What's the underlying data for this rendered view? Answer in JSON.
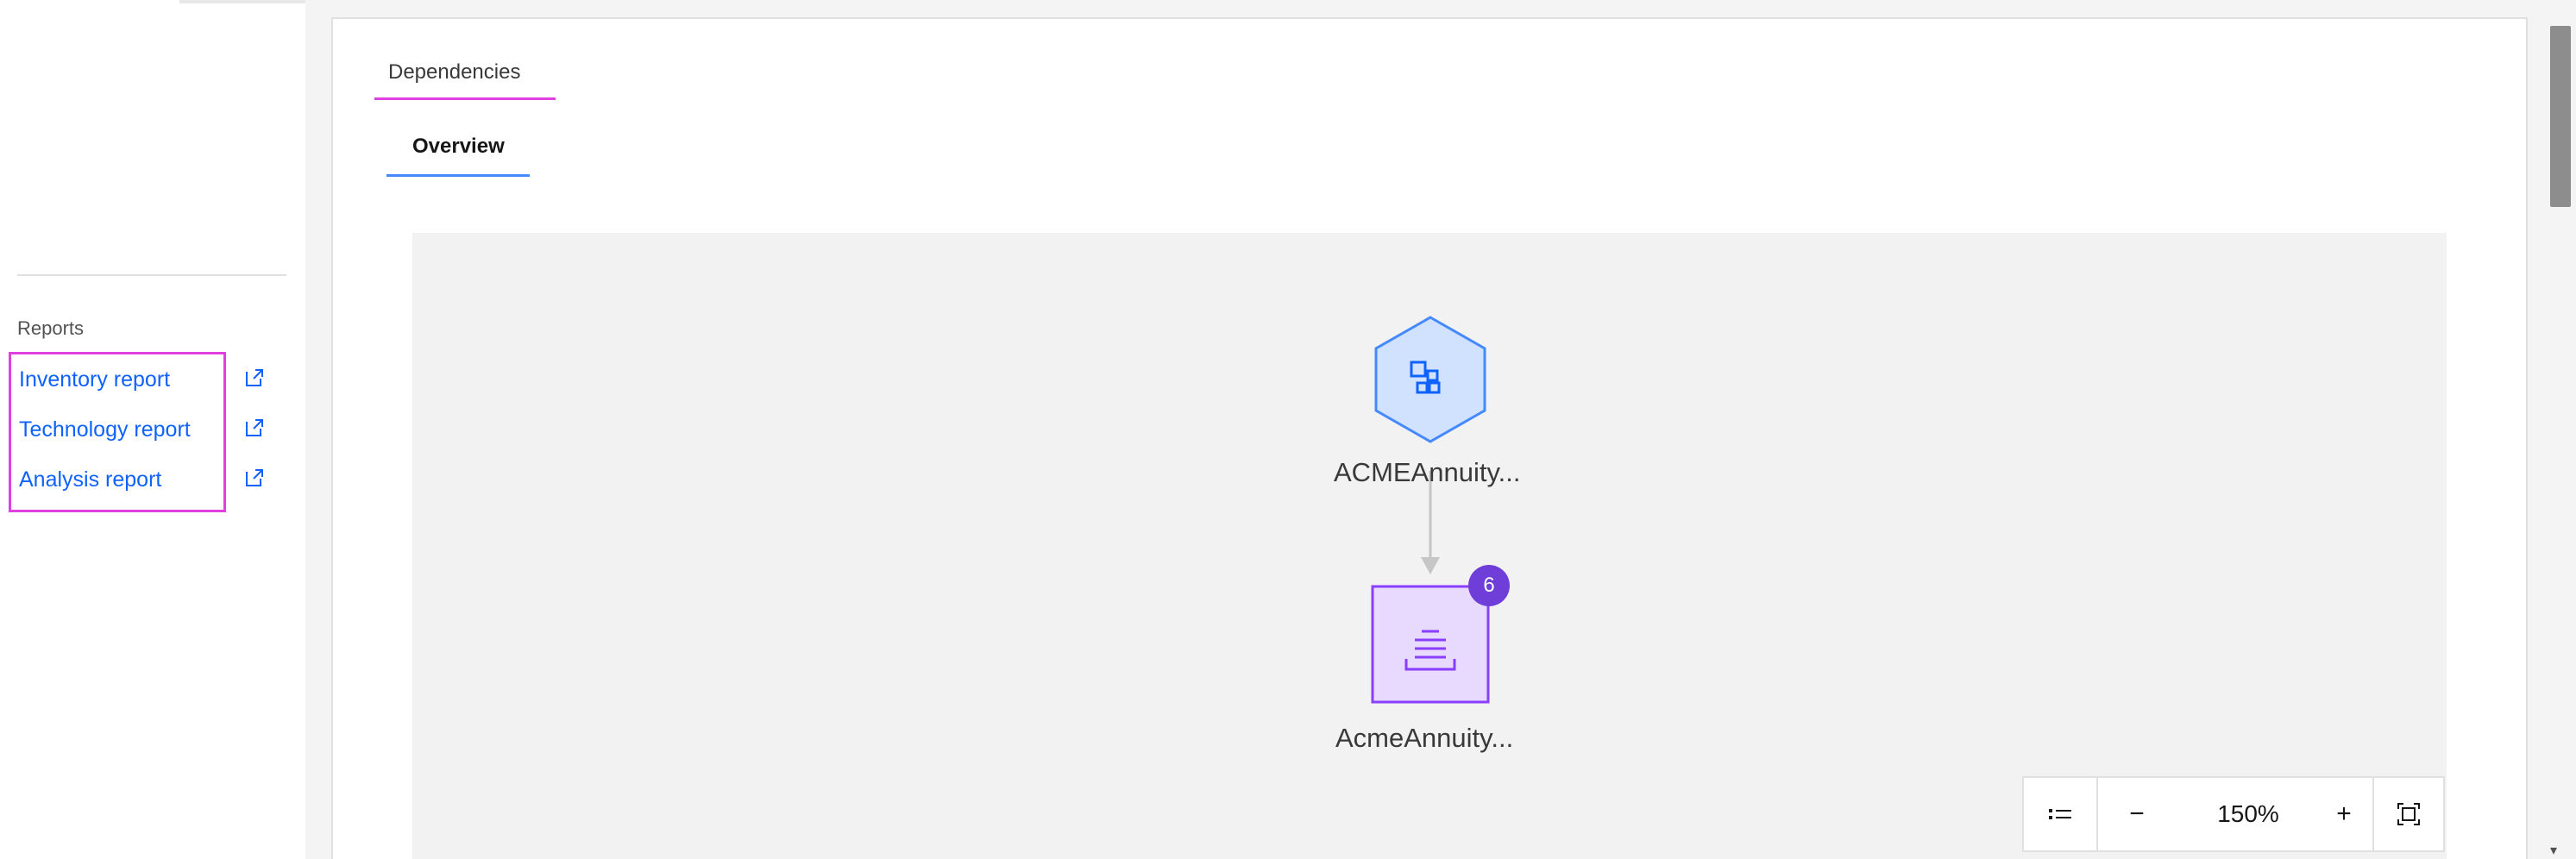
{
  "sidebar": {
    "section_label": "Reports",
    "reports": [
      {
        "label": "Inventory report",
        "icon": "external-link-icon"
      },
      {
        "label": "Technology report",
        "icon": "external-link-icon"
      },
      {
        "label": "Analysis report",
        "icon": "external-link-icon"
      }
    ]
  },
  "tabs": {
    "primary": "Dependencies",
    "secondary": "Overview"
  },
  "graph": {
    "nodes": [
      {
        "label": "ACMEAnnuity...",
        "icon": "application-icon",
        "shape": "hexagon"
      },
      {
        "label": "AcmeAnnuity...",
        "icon": "data-list-icon",
        "shape": "square",
        "badge": "6"
      }
    ]
  },
  "zoom": {
    "level": "150%",
    "decrease_label": "−",
    "increase_label": "+",
    "legend_icon": "list-legend-icon",
    "fit_icon": "fit-to-screen-icon"
  },
  "colors": {
    "link": "#0f62fe",
    "highlight": "#e040e0",
    "tab_underline": "#4589ff",
    "badge": "#6f3ed8",
    "app_node_fill": "#d0e2ff",
    "app_node_stroke": "#4589ff",
    "data_node_fill": "#e8daff",
    "data_node_stroke": "#8a3ffc"
  }
}
